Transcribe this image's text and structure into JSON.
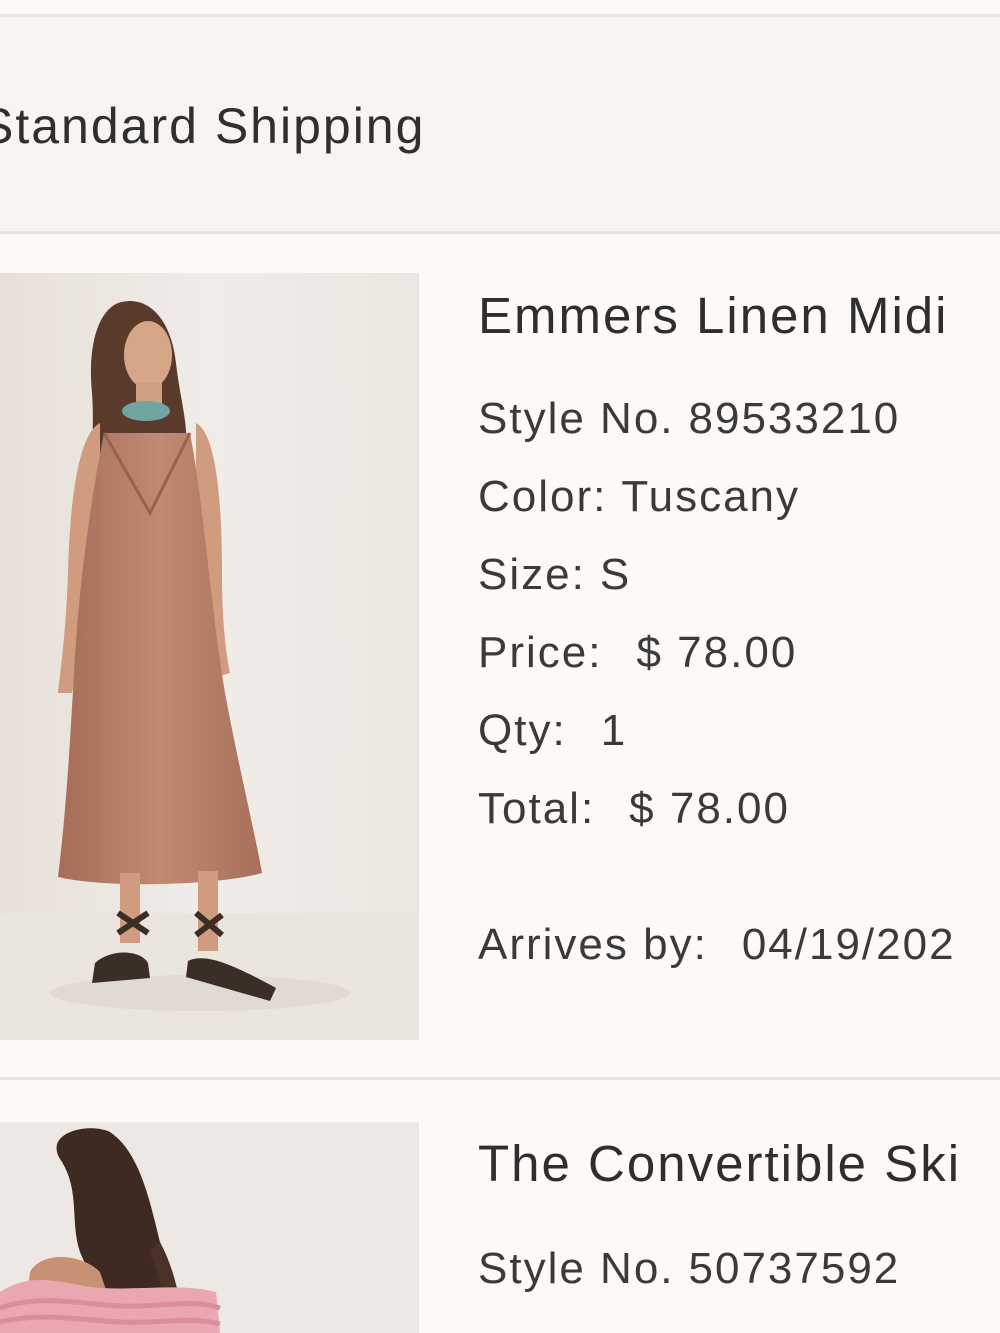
{
  "shipping": {
    "label": "Standard Shipping"
  },
  "items": [
    {
      "title": "Emmers Linen Midi",
      "style_label": "Style No.",
      "style_no": "89533210",
      "color_label": "Color:",
      "color": "Tuscany",
      "size_label": "Size:",
      "size": "S",
      "price_label": "Price:",
      "price": "$ 78.00",
      "qty_label": "Qty:",
      "qty": "1",
      "total_label": "Total:",
      "total": "$ 78.00",
      "arrives_label": "Arrives by:",
      "arrives": "04/19/202"
    },
    {
      "title": "The Convertible Ski",
      "style_label": "Style No.",
      "style_no": "50737592"
    }
  ],
  "colors": {
    "background": "#fcf9f7",
    "shipping_bar": "#f8f4f1",
    "divider": "#e7e3df",
    "text": "#333333",
    "dress_primary": "#b97f67"
  },
  "icons": []
}
